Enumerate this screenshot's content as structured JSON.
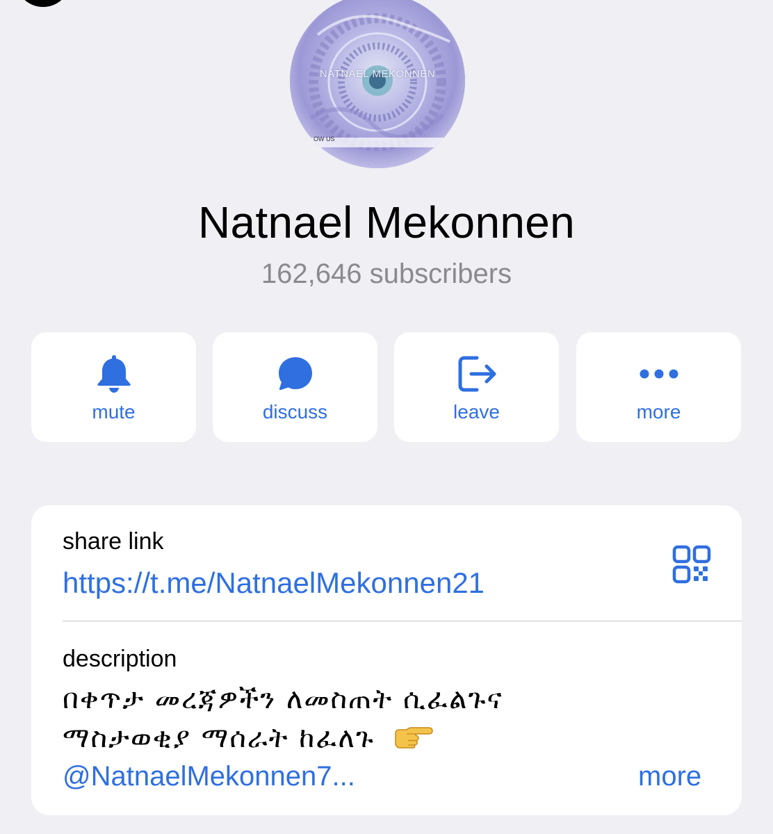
{
  "channel": {
    "name": "Natnael Mekonnen",
    "subscribers": "162,646 subscribers",
    "avatar_text": "NATNAEL MEKONNEN",
    "avatar_follow": "OW US"
  },
  "actions": [
    {
      "label": "mute",
      "icon": "bell-icon"
    },
    {
      "label": "discuss",
      "icon": "chat-bubble-icon"
    },
    {
      "label": "leave",
      "icon": "leave-icon"
    },
    {
      "label": "more",
      "icon": "ellipsis-icon"
    }
  ],
  "info": {
    "share_link_label": "share link",
    "share_link": "https://t.me/NatnaelMekonnen21",
    "description_label": "description",
    "description_line1": "በቀጥታ መረጃዎችን ለመስጠት ሲፈልጉና",
    "description_line2": "ማስታወቂያ ማሰራት ከፈለጉ",
    "handle": "@NatnaelMekonnen7...",
    "more_label": "more"
  },
  "colors": {
    "background": "#efeff4",
    "card": "#ffffff",
    "accent": "#2f6fe0",
    "secondary_text": "#8a8a8e"
  }
}
